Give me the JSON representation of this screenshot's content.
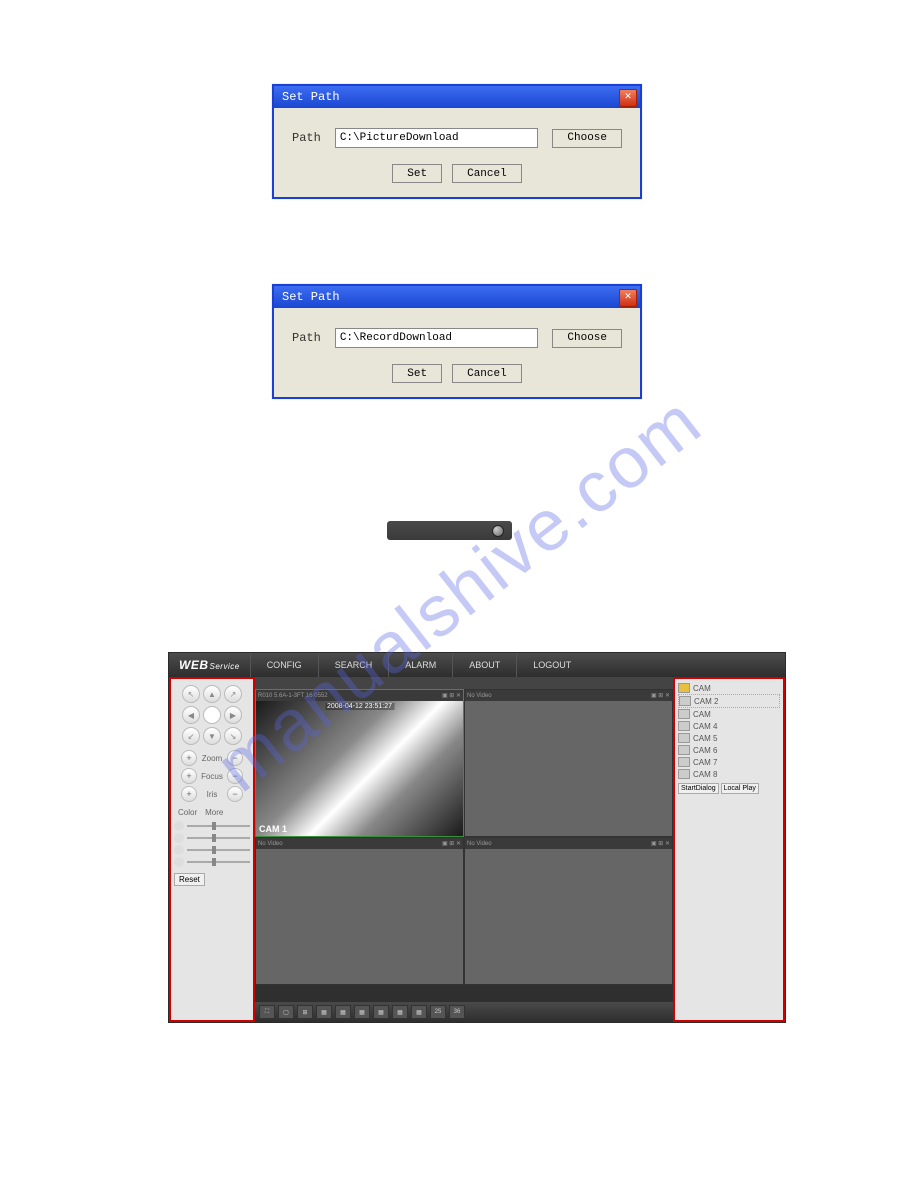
{
  "dialog1": {
    "title": "Set Path",
    "path_label": "Path",
    "path_value": "C:\\PictureDownload",
    "choose": "Choose",
    "set": "Set",
    "cancel": "Cancel"
  },
  "dialog2": {
    "title": "Set Path",
    "path_label": "Path",
    "path_value": "C:\\RecordDownload",
    "choose": "Choose",
    "set": "Set",
    "cancel": "Cancel"
  },
  "app": {
    "logo_main": "WEB",
    "logo_sub": "Service",
    "menu": [
      "CONFIG",
      "SEARCH",
      "ALARM",
      "ABOUT",
      "LOGOUT"
    ],
    "vid_header_left": "R010 5.6A-1-3FT 16 0552",
    "vid_header_right_tl": "No Video",
    "no_video": "No Video",
    "timestamp": "2008-04-12 23:51:27",
    "cam_tag": "CAM 1",
    "zoom": "Zoom",
    "focus": "Focus",
    "iris": "Iris",
    "color": "Color",
    "more": "More",
    "reset": "Reset",
    "footer_25": "25",
    "footer_36": "36",
    "cams": [
      "CAM",
      "CAM 2",
      "CAM",
      "CAM 4",
      "CAM 5",
      "CAM 6",
      "CAM 7",
      "CAM 8"
    ],
    "start_dialog": "StartDialog",
    "local_play": "Local Play"
  },
  "watermark": "manualshive.com"
}
